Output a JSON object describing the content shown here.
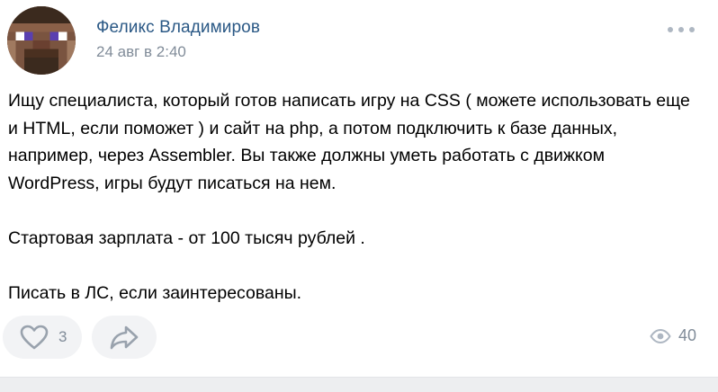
{
  "author": {
    "name": "Феликс Владимиров",
    "time": "24 авг в 2:40"
  },
  "post": {
    "paragraphs": [
      "Ищу специалиста, который готов написать игру на CSS ( можете использовать еще и HTML, если поможет ) и сайт на php, а потом подключить к базе данных, например, через Assembler. Вы также должны уметь работать с движком WordPress, игры будут писаться на нем.",
      "Стартовая зарплата - от 100 тысяч рублей .",
      "Писать в ЛС, если заинтересованы."
    ]
  },
  "actions": {
    "likes": "3",
    "views": "40"
  },
  "icons": {
    "more": "more-horizontal-icon",
    "like": "heart-outline-icon",
    "share": "share-arrow-icon",
    "views": "eye-icon"
  },
  "colors": {
    "link": "#2a5885",
    "secondary": "#818c99",
    "button_bg": "#f2f3f5",
    "icon": "#99a2ad"
  }
}
